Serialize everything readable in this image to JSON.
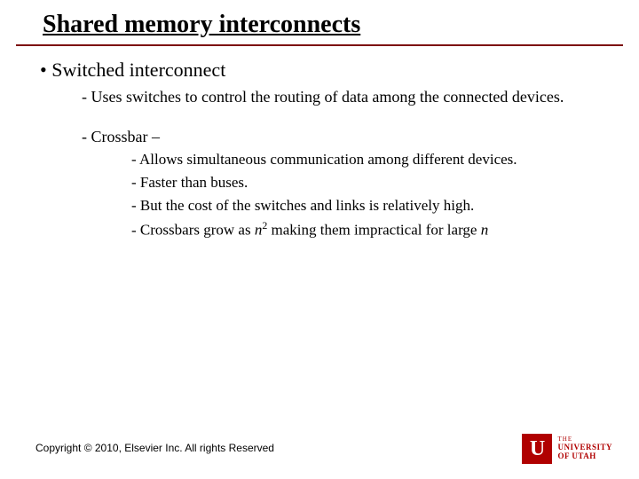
{
  "title": "Shared memory interconnects",
  "bullets": {
    "l1": "Switched interconnect",
    "l2a": "Uses switches to control the routing of data among the connected devices.",
    "l2b": "Crossbar –",
    "l3a": "Allows simultaneous communication among different devices.",
    "l3b": "Faster than buses.",
    "l3c": "But the cost of the switches and links is relatively high.",
    "l3d_pre": "Crossbars grow as ",
    "l3d_n": "n",
    "l3d_sup": "2",
    "l3d_post": " making them impractical for large ",
    "l3d_n2": "n"
  },
  "footer": "Copyright © 2010, Elsevier Inc. All rights Reserved",
  "logo": {
    "glyph": "U",
    "line1": "THE",
    "line2": "UNIVERSITY",
    "line3": "OF UTAH"
  }
}
